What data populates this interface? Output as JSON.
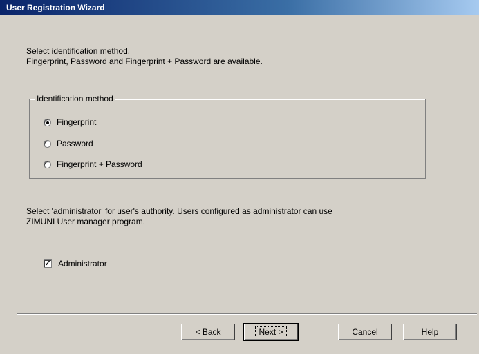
{
  "window": {
    "title": "User Registration Wizard"
  },
  "intro": {
    "line1": "Select identification method.",
    "line2": "Fingerprint, Password and Fingerprint + Password are available."
  },
  "identification": {
    "group_title": "Identification method",
    "options": [
      {
        "label": "Fingerprint",
        "checked": true
      },
      {
        "label": "Password",
        "checked": false
      },
      {
        "label": "Fingerprint + Password",
        "checked": false
      }
    ]
  },
  "authority": {
    "line1": "Select 'administrator' for user's authority. Users configured as administrator can use",
    "line2": "ZIMUNI User manager program.",
    "checkbox_label": "Administrator",
    "checked": true
  },
  "buttons": {
    "back": "< Back",
    "next": "Next >",
    "cancel": "Cancel",
    "help": "Help"
  }
}
